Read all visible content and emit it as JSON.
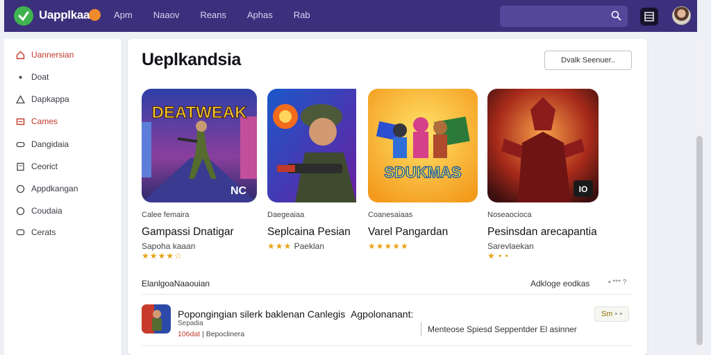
{
  "app": {
    "title": "Uapplkaa"
  },
  "nav": [
    "Apm",
    "Naaov",
    "Reans",
    "Aphas",
    "Rab"
  ],
  "search": {
    "placeholder": ""
  },
  "sidebar": {
    "items": [
      {
        "label": "Uannersian",
        "icon": "home-icon",
        "active": true
      },
      {
        "label": "Doat",
        "icon": "dot-icon",
        "active": false
      },
      {
        "label": "Dapkappa",
        "icon": "triangle-icon",
        "active": false
      },
      {
        "label": "Cames",
        "icon": "games-icon",
        "active": true
      },
      {
        "label": "Dangidaia",
        "icon": "pad-icon",
        "active": false
      },
      {
        "label": "Ceorict",
        "icon": "book-icon",
        "active": false
      },
      {
        "label": "Appdkangan",
        "icon": "circle-icon",
        "active": false
      },
      {
        "label": "Coudaia",
        "icon": "circle-icon",
        "active": false
      },
      {
        "label": "Cerats",
        "icon": "chat-icon",
        "active": false
      }
    ]
  },
  "main": {
    "title": "Ueplkandsia",
    "top_button": "Dvalk Seenuer..",
    "apps": [
      {
        "category": "Calee femaira",
        "name": "Gampassi Dnatigar",
        "sub": "Sapoha kaaan",
        "rating": 4,
        "tile_text": "DEATWEAK",
        "badge": "NC"
      },
      {
        "category": "Daegeaiaa",
        "name": "Seplcaina Pesian",
        "sub": "Paeklan",
        "rating": 3,
        "tile_text": "",
        "badge": ""
      },
      {
        "category": "Coanesaiaas",
        "name": "Varel Pangardan",
        "sub": "",
        "rating": 5,
        "tile_text": "SDUKMAS",
        "badge": ""
      },
      {
        "category": "Noseaocioca",
        "name": "Pesinsdan arecapantia",
        "sub": "Sarevlaekan",
        "rating": 1,
        "tile_text": "",
        "badge": "IO"
      }
    ],
    "section": {
      "label": "ElanlgoaNaaouian",
      "link": "Adkloge eodkas",
      "more": "• *** ?"
    },
    "row": {
      "title": "Popongingian silerk baklenan Canlegis",
      "title_extra": "Agpolonanant:",
      "sub": "Sepadia",
      "meta_number": "106dat",
      "meta_text": "Bepoclinera",
      "desc": "Menteose Spiesd Seppentder El asinner",
      "button": "Sm"
    }
  },
  "colors": {
    "topbar": "#3c2f7c",
    "accent": "#c0392b",
    "star": "#e8a317"
  }
}
